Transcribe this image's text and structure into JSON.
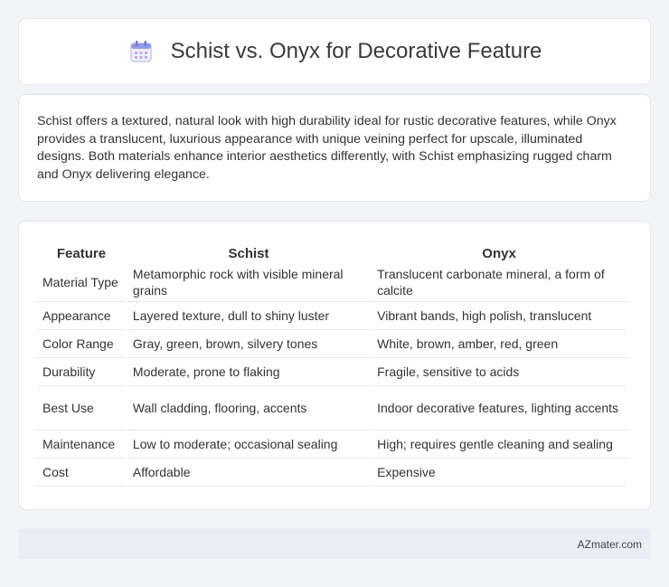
{
  "header": {
    "title": "Schist vs. Onyx for Decorative Feature",
    "icon": "calendar-icon"
  },
  "summary": {
    "text": "Schist offers a textured, natural look with high durability ideal for rustic decorative features, while Onyx provides a translucent, luxurious appearance with unique veining perfect for upscale, illuminated designs. Both materials enhance interior aesthetics differently, with Schist emphasizing rugged charm and Onyx delivering elegance."
  },
  "table": {
    "headers": [
      "Feature",
      "Schist",
      "Onyx"
    ],
    "rows": [
      [
        "Material Type",
        "Metamorphic rock with visible mineral grains",
        "Translucent carbonate mineral, a form of calcite"
      ],
      [
        "Appearance",
        "Layered texture, dull to shiny luster",
        "Vibrant bands, high polish, translucent"
      ],
      [
        "Color Range",
        "Gray, green, brown, silvery tones",
        "White, brown, amber, red, green"
      ],
      [
        "Durability",
        "Moderate, prone to flaking",
        "Fragile, sensitive to acids"
      ],
      [
        "Best Use",
        "Wall cladding, flooring, accents",
        "Indoor decorative features, lighting accents"
      ],
      [
        "Maintenance",
        "Low to moderate; occasional sealing",
        "High; requires gentle cleaning and sealing"
      ],
      [
        "Cost",
        "Affordable",
        "Expensive"
      ]
    ]
  },
  "footer": {
    "brand": "AZmater.com"
  },
  "colors": {
    "background": "#f3f4f7",
    "card": "#ffffff",
    "footer": "#e9eef6"
  }
}
